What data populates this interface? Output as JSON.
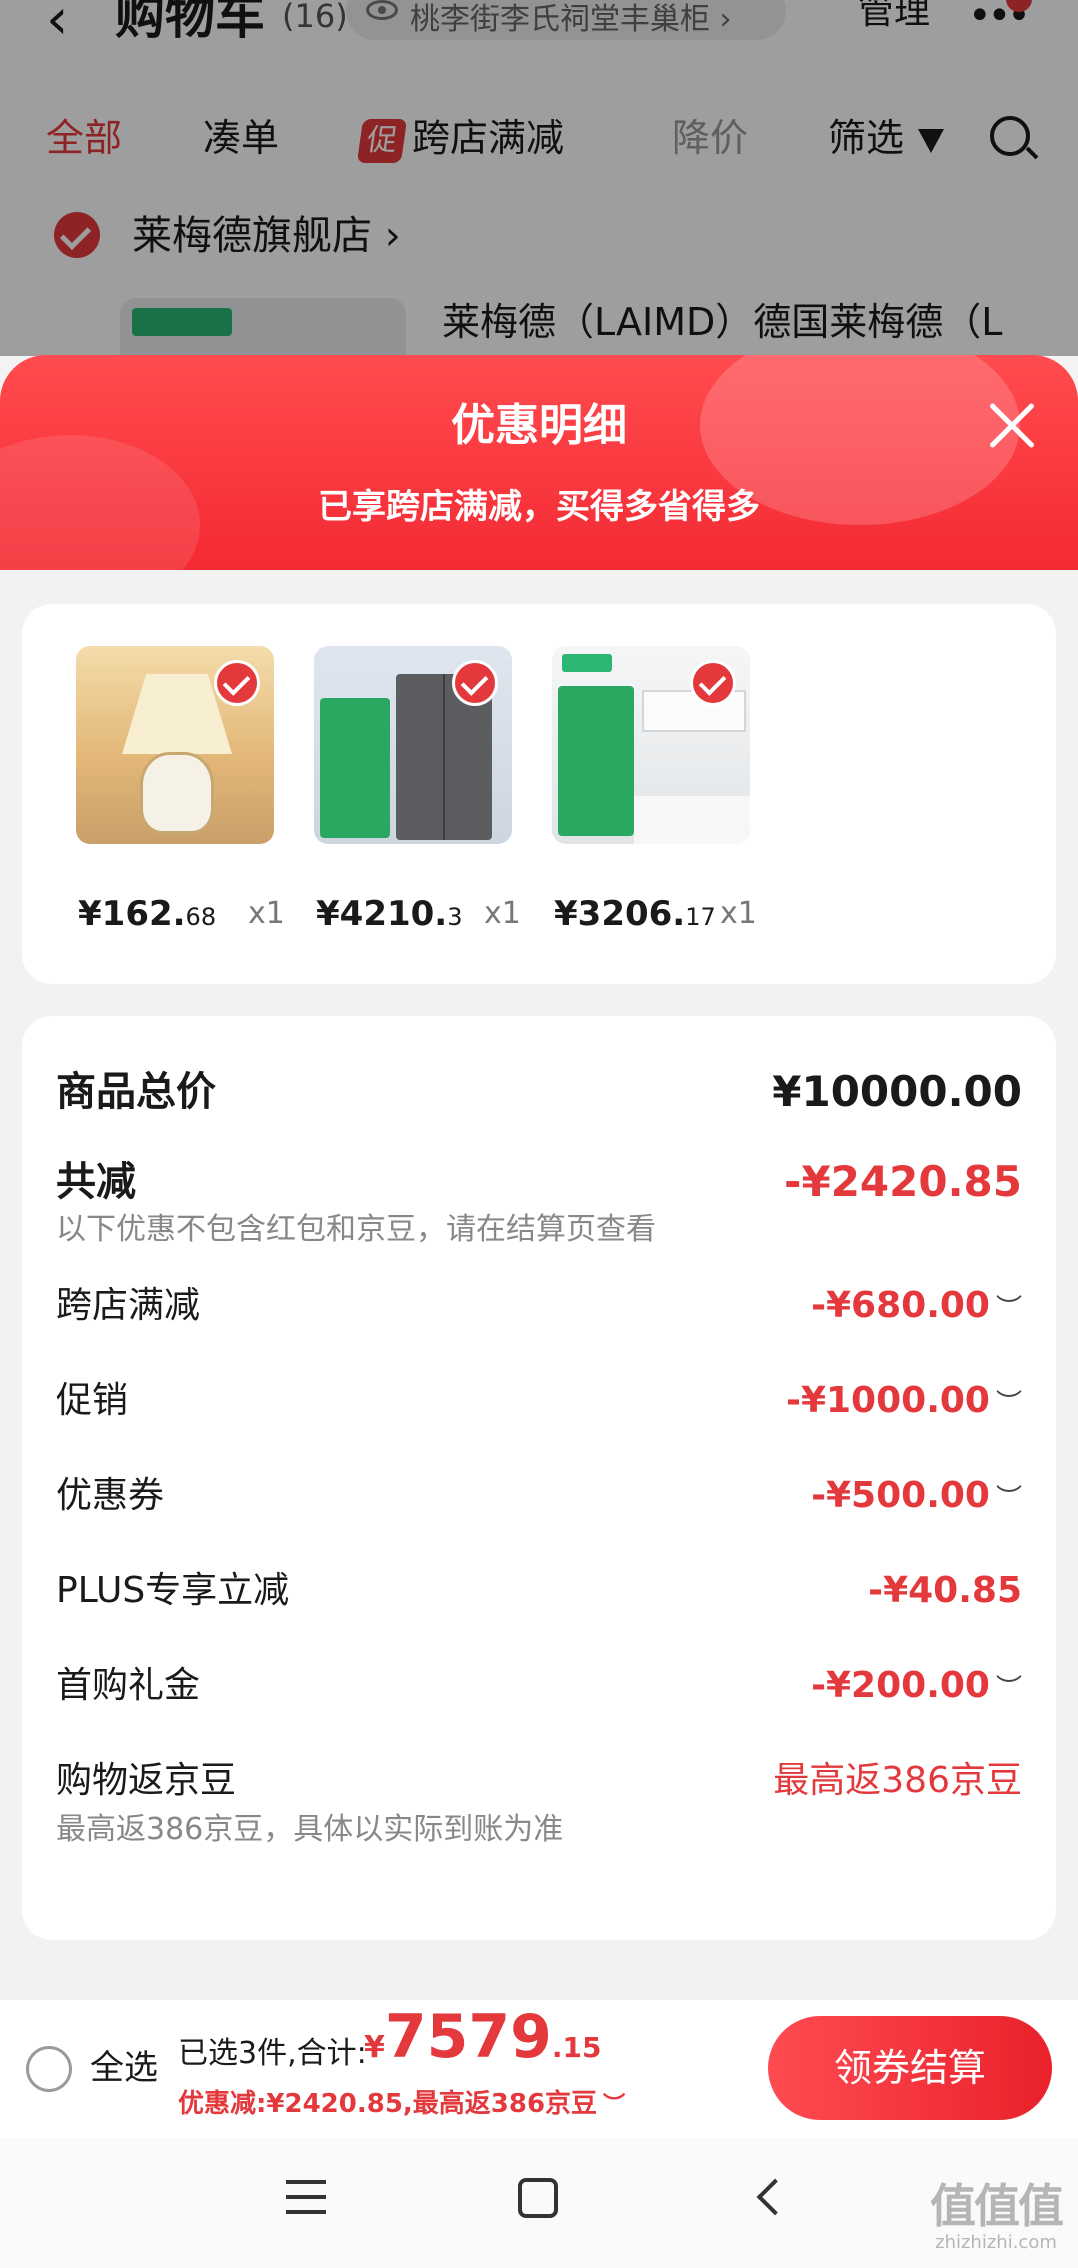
{
  "cart_header": {
    "title": "购物车",
    "count": "(16)",
    "address": "桃李街李氏祠堂丰巢柜 ›",
    "manage": "管理"
  },
  "filter_tabs": [
    {
      "label": "全部",
      "active": true
    },
    {
      "label": "凑单"
    },
    {
      "label": "跨店满减",
      "badge": "促"
    },
    {
      "label": "降价",
      "disabled": true
    },
    {
      "label": "筛选"
    }
  ],
  "store": {
    "name": "莱梅德旗舰店 ›",
    "product_name": "莱梅德（LAIMD）德国莱梅德（L"
  },
  "sheet": {
    "title": "优惠明细",
    "subtitle": "已享跨店满减，买得多省得多"
  },
  "products": [
    {
      "price_int": "¥162.",
      "price_dec": "68",
      "qty": "x1"
    },
    {
      "price_int": "¥4210.",
      "price_dec": "3",
      "qty": "x1"
    },
    {
      "price_int": "¥3206.",
      "price_dec": "17",
      "qty": "x1"
    }
  ],
  "summary": {
    "total_label": "商品总价",
    "total_value": "¥10000.00",
    "reduce_label": "共减",
    "reduce_value": "-¥2420.85",
    "reduce_hint": "以下优惠不包含红包和京豆，请在结算页查看",
    "items": [
      {
        "label": "跨店满减",
        "value": "-¥680.00",
        "expandable": true
      },
      {
        "label": "促销",
        "value": "-¥1000.00",
        "expandable": true
      },
      {
        "label": "优惠券",
        "value": "-¥500.00",
        "expandable": true
      },
      {
        "label": "PLUS专享立减",
        "value": "-¥40.85",
        "expandable": false
      },
      {
        "label": "首购礼金",
        "value": "-¥200.00",
        "expandable": true
      }
    ],
    "rebate_label": "购物返京豆",
    "rebate_value": "最高返386京豆",
    "rebate_hint": "最高返386京豆，具体以实际到账为准"
  },
  "footer": {
    "select_all": "全选",
    "selected_text": "已选3件,合计:",
    "total_currency": "¥",
    "total_int": "7579",
    "total_dec": ".15",
    "discount_text": "优惠减:¥2420.85,最高返386京豆",
    "checkout_label": "领券结算"
  },
  "watermark": {
    "logo": "值值值",
    "text": "zhizhizhi.com"
  },
  "colors": {
    "accent": "#e4393c",
    "header_gradient_top": "#ff4b4f",
    "header_gradient_bottom": "#f42a33"
  }
}
